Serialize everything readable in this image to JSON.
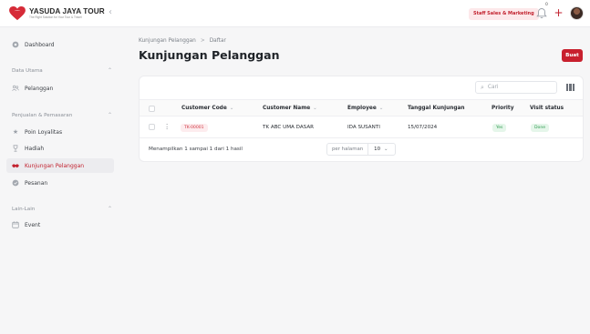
{
  "header": {
    "logo_name": "YASUDA JAYA TOUR",
    "logo_tagline": "The Right Solution for Your Tour & Travel",
    "collapse_icon": "chevron-left-icon",
    "role": "Staff Sales & Marketing",
    "notification_count": "0",
    "brand_color": "#c8202e"
  },
  "sidebar": {
    "dashboard": "Dashboard",
    "groups": [
      {
        "label": "Data Utama",
        "items": [
          "Pelanggan"
        ]
      },
      {
        "label": "Penjualan & Pemasaran",
        "items": [
          "Poin Loyalitas",
          "Hadiah",
          "Kunjungan Pelanggan",
          "Pesanan"
        ]
      },
      {
        "label": "Lain-Lain",
        "items": [
          "Event"
        ]
      }
    ],
    "active_item": "Kunjungan Pelanggan"
  },
  "main": {
    "breadcrumb": [
      "Kunjungan Pelanggan",
      "Daftar"
    ],
    "title": "Kunjungan Pelanggan",
    "create_label": "Buat",
    "search_placeholder": "Cari",
    "columns": [
      "Customer Code",
      "Customer Name",
      "Employee",
      "Tanggal Kunjungan",
      "Priority",
      "Visit status"
    ],
    "rows": [
      {
        "customer_code": "TK-00001",
        "customer_name": "TK ABC UMA DASAR",
        "employee": "IDA SUSANTI",
        "tanggal_kunjungan": "15/07/2024",
        "priority": "Yes",
        "visit_status": "Done"
      }
    ],
    "summary": "Menampilkan 1 sampai 1 dari 1 hasil",
    "per_page_label": "per halaman",
    "per_page_value": "10"
  }
}
